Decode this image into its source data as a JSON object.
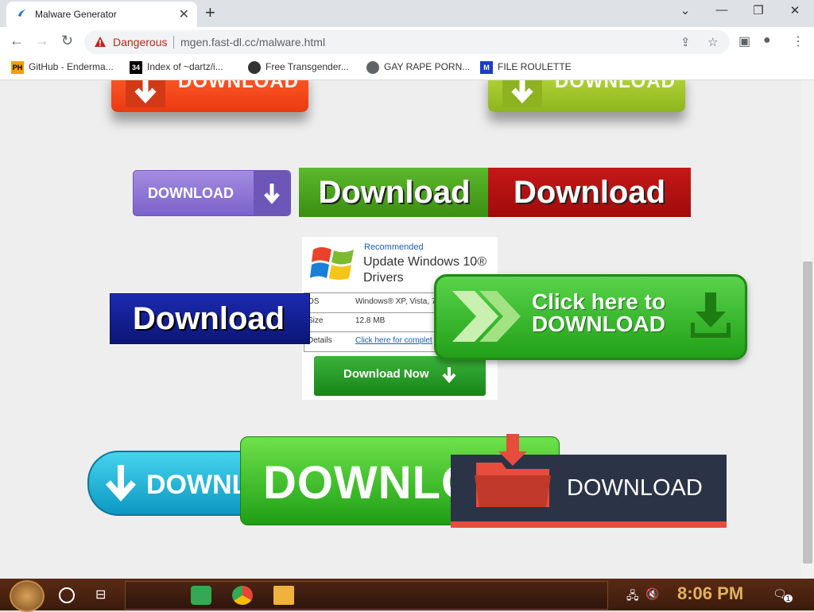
{
  "browser": {
    "tab_title": "Malware Generator",
    "security_label": "Dangerous",
    "url": "mgen.fast-dl.cc/malware.html",
    "bookmarks": [
      {
        "label": "GitHub - Enderma...",
        "icon_text": "PH"
      },
      {
        "label": "Index of ~dartz/i...",
        "icon_text": "34"
      },
      {
        "label": "Free Transgender...",
        "icon_text": ""
      },
      {
        "label": "GAY RAPE PORN...",
        "icon_text": ""
      },
      {
        "label": "FILE ROULETTE",
        "icon_text": "M"
      }
    ],
    "colors": {
      "danger": "#c5221f"
    }
  },
  "page": {
    "buttons": {
      "red_top": "DOWNLOAD",
      "green_top": "DOWNLOAD",
      "purple": "DOWNLOAD",
      "green_wide": "Download",
      "darkred": "Download",
      "navy": "Download",
      "click_line1": "Click here to",
      "click_line2": "DOWNLOAD",
      "cyan": "DOWNL",
      "green_big": "DOWNLO",
      "navy_folder": "DOWNLOAD"
    },
    "ad": {
      "recommended": "Recommended",
      "title_line1": "Update Windows 10®",
      "title_line2": "Drivers",
      "rows": [
        {
          "key": "OS",
          "value": "Windows® XP, Vista, 7"
        },
        {
          "key": "Size",
          "value": "12.8 MB"
        },
        {
          "key": "Details",
          "value": "Click here for complet"
        }
      ],
      "button": "Download Now"
    }
  },
  "taskbar": {
    "clock": "8:06 PM",
    "notification_count": "1"
  }
}
